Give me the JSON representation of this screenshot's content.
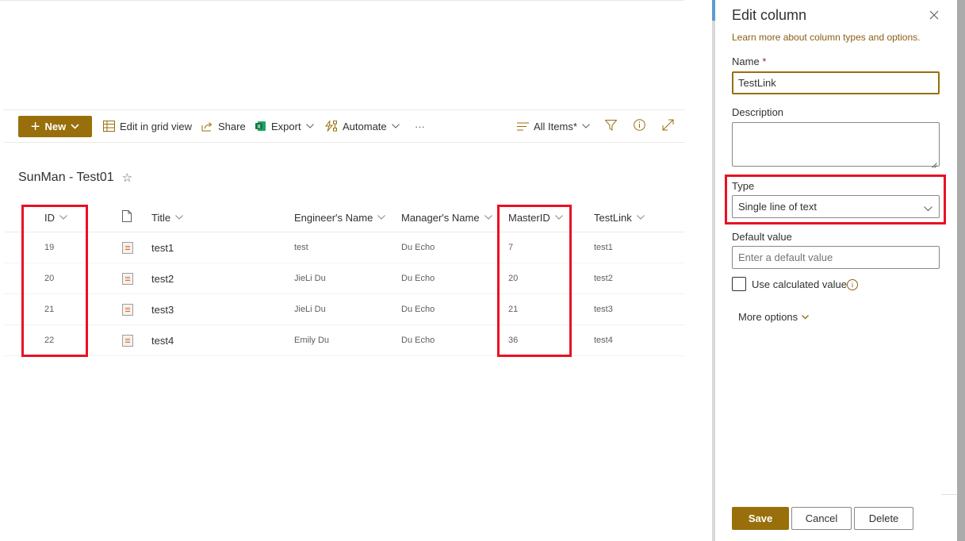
{
  "commandbar": {
    "new_label": "New",
    "edit_grid_label": "Edit in grid view",
    "share_label": "Share",
    "export_label": "Export",
    "automate_label": "Automate",
    "more_label": "···",
    "view_label": "All Items*"
  },
  "list": {
    "title": "SunMan - Test01",
    "columns": {
      "id": "ID",
      "title": "Title",
      "engineer": "Engineer's Name",
      "manager": "Manager's Name",
      "master_id": "MasterID",
      "test_link": "TestLink"
    },
    "rows": [
      {
        "id": "19",
        "title": "test1",
        "engineer": "test",
        "manager": "Du Echo",
        "master_id": "7",
        "test_link": "test1"
      },
      {
        "id": "20",
        "title": "test2",
        "engineer": "JieLi Du",
        "manager": "Du Echo",
        "master_id": "20",
        "test_link": "test2"
      },
      {
        "id": "21",
        "title": "test3",
        "engineer": "JieLi Du",
        "manager": "Du Echo",
        "master_id": "21",
        "test_link": "test3"
      },
      {
        "id": "22",
        "title": "test4",
        "engineer": "Emily Du",
        "manager": "Du Echo",
        "master_id": "36",
        "test_link": "test4"
      }
    ]
  },
  "panel": {
    "title": "Edit column",
    "learn_more": "Learn more about column types and options.",
    "name_label": "Name",
    "required_mark": "*",
    "name_value": "TestLink",
    "description_label": "Description",
    "description_value": "",
    "type_label": "Type",
    "type_value": "Single line of text",
    "default_label": "Default value",
    "default_placeholder": "Enter a default value",
    "calculated_label": "Use calculated value",
    "more_options": "More options",
    "save": "Save",
    "cancel": "Cancel",
    "delete": "Delete"
  },
  "colors": {
    "accent": "#986f0b",
    "highlight_box": "#e81123",
    "link": "#8a6116"
  }
}
